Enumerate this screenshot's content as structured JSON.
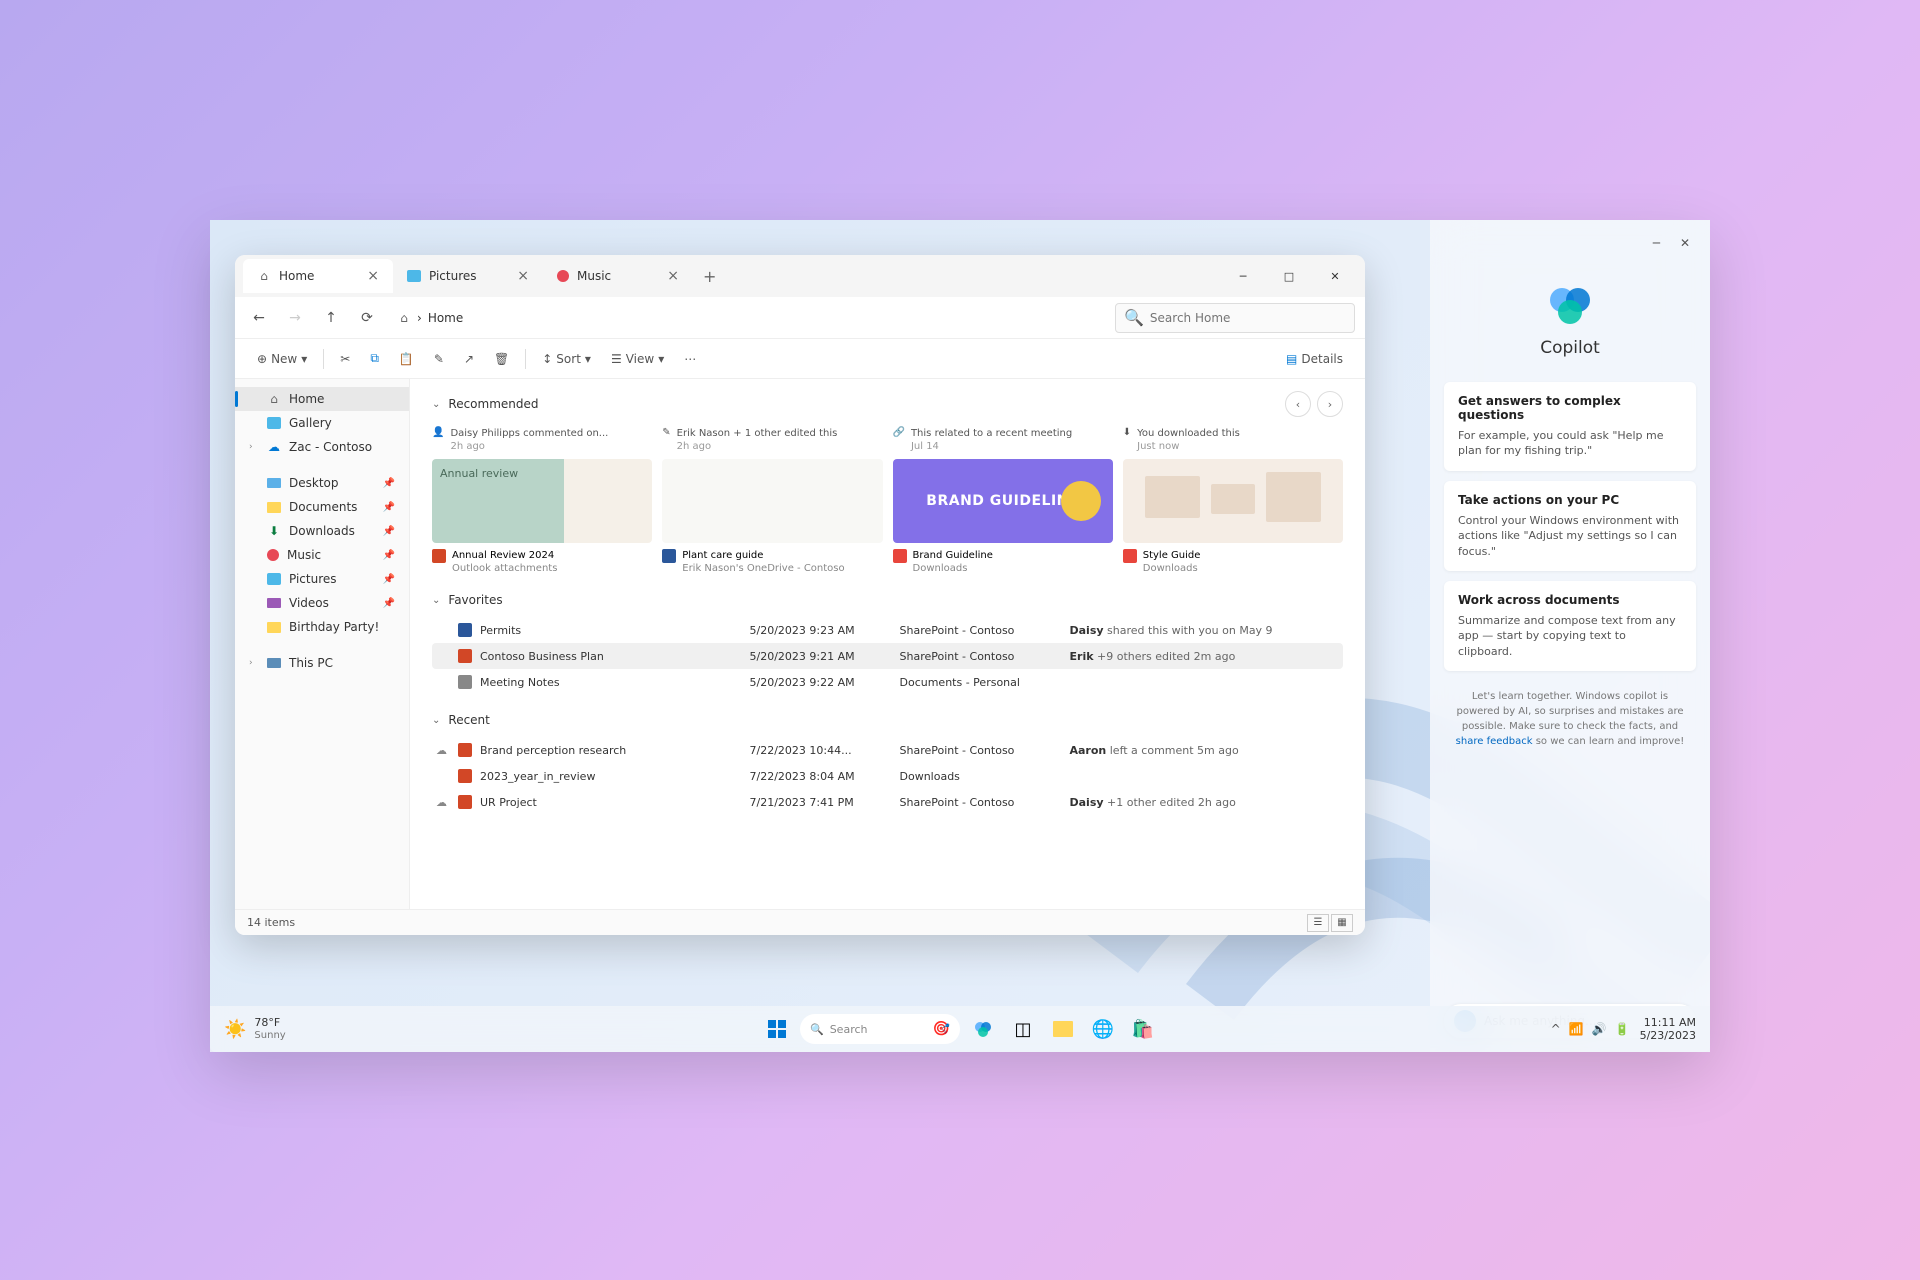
{
  "tabs": [
    {
      "label": "Home",
      "active": true
    },
    {
      "label": "Pictures",
      "active": false
    },
    {
      "label": "Music",
      "active": false
    }
  ],
  "breadcrumb": {
    "location": "Home"
  },
  "search": {
    "placeholder": "Search Home"
  },
  "toolbar": {
    "new": "New",
    "sort": "Sort",
    "view": "View",
    "details": "Details"
  },
  "sidebar": {
    "home": "Home",
    "gallery": "Gallery",
    "user_cloud": "Zac - Contoso",
    "desktop": "Desktop",
    "documents": "Documents",
    "downloads": "Downloads",
    "music": "Music",
    "pictures": "Pictures",
    "videos": "Videos",
    "birthday": "Birthday Party!",
    "this_pc": "This PC"
  },
  "sections": {
    "recommended": "Recommended",
    "favorites": "Favorites",
    "recent": "Recent"
  },
  "recommended": [
    {
      "meta": "Daisy Philipps commented on...",
      "meta_sub": "2h ago",
      "title": "Annual Review 2024",
      "sub": "Outlook attachments"
    },
    {
      "meta": "Erik Nason + 1 other edited this",
      "meta_sub": "2h ago",
      "title": "Plant care guide",
      "sub": "Erik Nason's OneDrive - Contoso"
    },
    {
      "meta": "This related to a recent meeting",
      "meta_sub": "Jul 14",
      "title": "Brand Guideline",
      "sub": "Downloads",
      "thumb_text": "BRAND GUIDELINE"
    },
    {
      "meta": "You downloaded this",
      "meta_sub": "Just now",
      "title": "Style Guide",
      "sub": "Downloads"
    }
  ],
  "favorites": [
    {
      "name": "Permits",
      "date": "5/20/2023 9:23 AM",
      "loc": "SharePoint - Contoso",
      "activity_user": "Daisy",
      "activity_rest": " shared this with you on May 9"
    },
    {
      "name": "Contoso Business Plan",
      "date": "5/20/2023 9:21 AM",
      "loc": "SharePoint - Contoso",
      "activity_user": "Erik",
      "activity_rest": " +9 others edited 2m ago"
    },
    {
      "name": "Meeting Notes",
      "date": "5/20/2023 9:22 AM",
      "loc": "Documents - Personal",
      "activity_user": "",
      "activity_rest": ""
    }
  ],
  "recent": [
    {
      "name": "Brand perception research",
      "date": "7/22/2023 10:44...",
      "loc": "SharePoint - Contoso",
      "activity_user": "Aaron",
      "activity_rest": " left a comment 5m ago"
    },
    {
      "name": "2023_year_in_review",
      "date": "7/22/2023 8:04 AM",
      "loc": "Downloads",
      "activity_user": "",
      "activity_rest": ""
    },
    {
      "name": "UR Project",
      "date": "7/21/2023 7:41 PM",
      "loc": "SharePoint - Contoso",
      "activity_user": "Daisy",
      "activity_rest": " +1 other edited 2h ago"
    }
  ],
  "statusbar": {
    "count": "14 items"
  },
  "copilot": {
    "title": "Copilot",
    "cards": [
      {
        "title": "Get answers to complex questions",
        "text": "For example, you could ask \"Help me plan for my fishing trip.\""
      },
      {
        "title": "Take actions on your PC",
        "text": "Control your Windows environment with actions like \"Adjust my settings so I can focus.\""
      },
      {
        "title": "Work across documents",
        "text": "Summarize and compose text from any app — start by copying text to clipboard."
      }
    ],
    "footer_pre": "Let's learn together. Windows copilot is powered by AI, so surprises and mistakes are possible. Make sure to check the facts, and ",
    "footer_link": "share feedback",
    "footer_post": " so we can learn and improve!",
    "input_placeholder": "Ask me anything..."
  },
  "taskbar": {
    "weather_temp": "78°F",
    "weather_cond": "Sunny",
    "search": "Search",
    "time": "11:11 AM",
    "date": "5/23/2023"
  }
}
